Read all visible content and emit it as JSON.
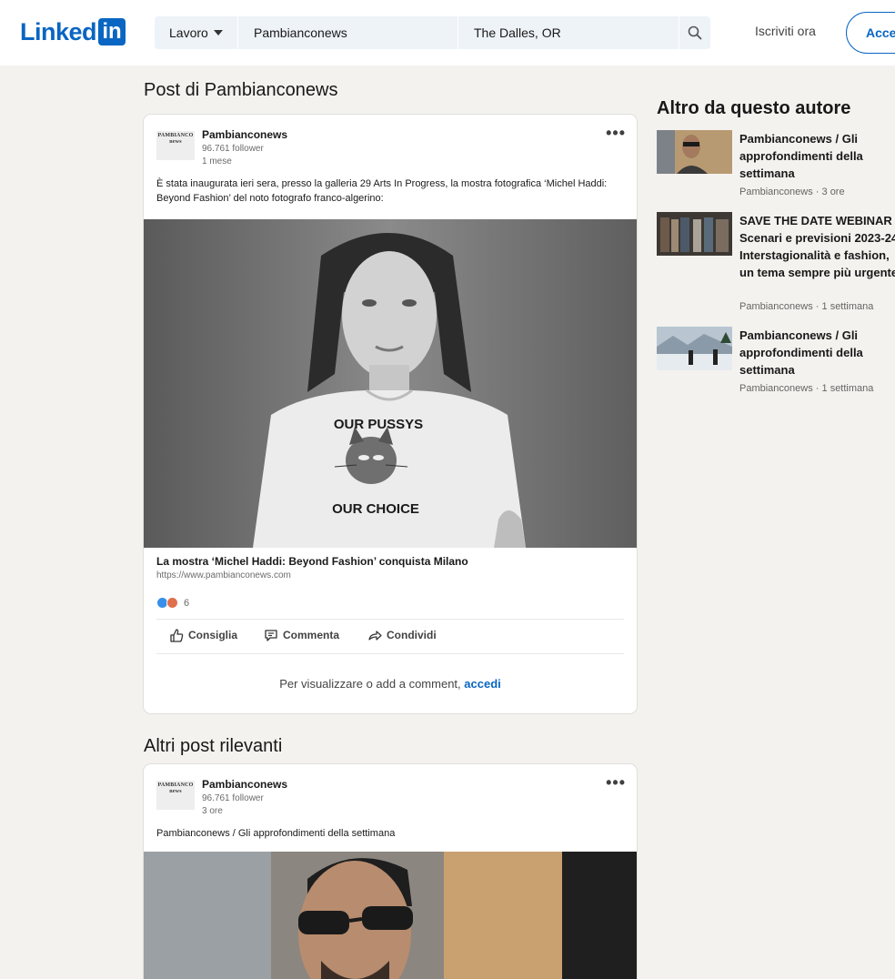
{
  "header": {
    "logo_word": "Linked",
    "logo_box": "in",
    "jobs_dropdown": "Lavoro",
    "keyword_value": "Pambianconews",
    "location_value": "The Dalles, OR",
    "join_link": "Iscriviti ora",
    "signin_button": "Accedi",
    "brand_color": "#0a66c2"
  },
  "main": {
    "section_title": "Post di Pambianconews",
    "post": {
      "author": "Pambianconews",
      "author_logo_text": "PAMBIANCO news",
      "followers": "96.761 follower",
      "time": "1 mese",
      "commentary": "È stata inaugurata ieri sera, presso la galleria 29 Arts In Progress, la mostra fotografica ‘Michel Haddi: Beyond Fashion’ del noto fotografo franco-algerino:",
      "shirt_line1": "OUR PUSSYS",
      "shirt_line2": "OUR CHOICE",
      "article_title": "La mostra ‘Michel Haddi: Beyond Fashion’ conquista Milano",
      "article_url": "https://www.pambianconews.com",
      "reaction_count": "6",
      "actions": [
        "Consiglia",
        "Commenta",
        "Condividi"
      ],
      "signin_prompt": "Per visualizzare o add a comment,",
      "signin_link": "accedi"
    },
    "related_title": "Altri post rilevanti",
    "related_post": {
      "author": "Pambianconews",
      "author_logo_text": "PAMBIANCO news",
      "followers": "96.761 follower",
      "time": "3 ore",
      "commentary": "Pambianconews / Gli approfondimenti della settimana"
    }
  },
  "rail": {
    "title": "Altro da questo autore",
    "items": [
      {
        "title": "Pambianconews / Gli approfondimenti della settimana",
        "author": "Pambianconews",
        "time": "3 ore"
      },
      {
        "title": "SAVE THE DATE WEBINAR Scenari e previsioni 2023-24. Interstagionalità e fashion, un tema sempre più urgente",
        "author": "Pambianconews",
        "time": "1 settimana"
      },
      {
        "title": "Pambianconews / Gli approfondimenti della settimana",
        "author": "Pambianconews",
        "time": "1 settimana"
      }
    ],
    "meta_separator": "·"
  },
  "icons": [
    "caret-down-icon",
    "search-icon",
    "more-icon",
    "like-icon",
    "comment-icon",
    "share-icon",
    "like-reaction-icon",
    "love-reaction-icon"
  ]
}
